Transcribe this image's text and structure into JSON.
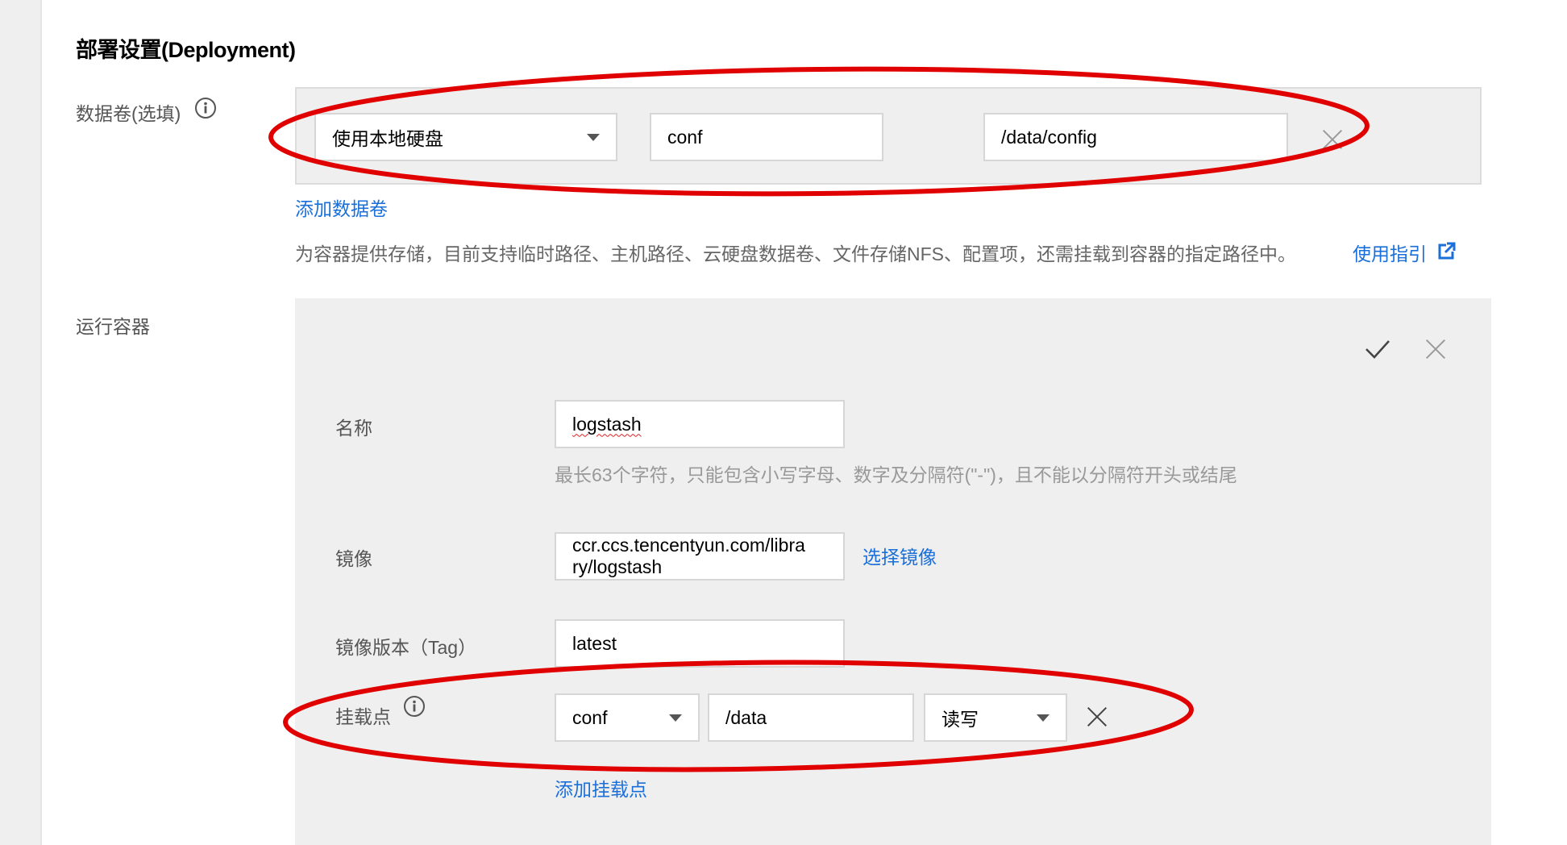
{
  "deployment": {
    "title": "部署设置(Deployment)"
  },
  "volumes": {
    "label": "数据卷(选填)",
    "type_value": "使用本地硬盘",
    "name_value": "conf",
    "path_value": "/data/config",
    "add_link": "添加数据卷",
    "hint": "为容器提供存储，目前支持临时路径、主机路径、云硬盘数据卷、文件存储NFS、配置项，还需挂载到容器的指定路径中。",
    "guide_link": "使用指引"
  },
  "container": {
    "label": "运行容器",
    "name_label": "名称",
    "name_value": "logstash",
    "name_hint": "最长63个字符，只能包含小写字母、数字及分隔符(\"-\")，且不能以分隔符开头或结尾",
    "image_label": "镜像",
    "image_value_line1": "ccr.ccs.tencentyun.com/libra",
    "image_value_line2": "ry/logstash",
    "select_image_link": "选择镜像",
    "tag_label": "镜像版本（Tag）",
    "tag_value": "latest",
    "mount_label": "挂载点",
    "mount_volume_value": "conf",
    "mount_path_value": "/data",
    "mount_mode_value": "读写",
    "add_mount_link": "添加挂载点"
  },
  "colors": {
    "link": "#1a6fd8",
    "annotation": "#e00000",
    "panel": "#efefef"
  },
  "icons": [
    "info-icon",
    "chevron-down-icon",
    "close-icon",
    "external-link-icon",
    "check-icon"
  ]
}
